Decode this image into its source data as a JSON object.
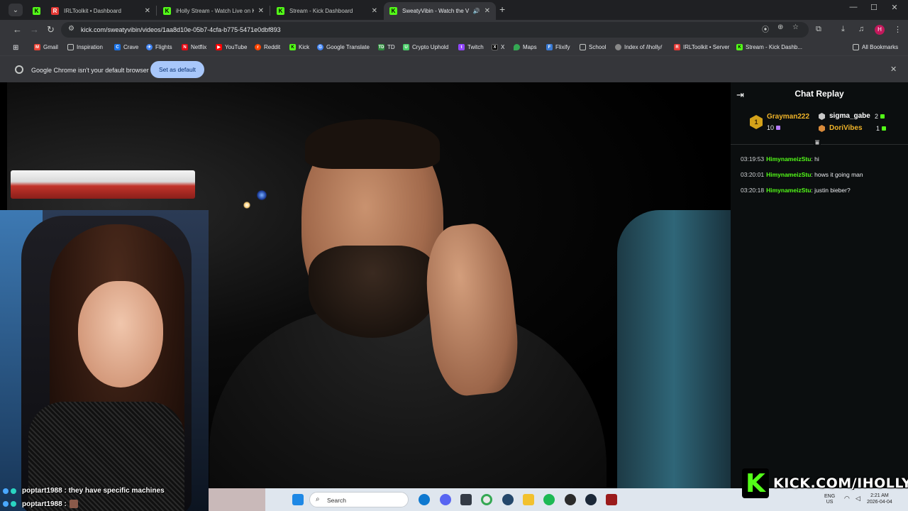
{
  "browser": {
    "tabs": [
      {
        "title": "",
        "favicon": "kick",
        "active": false
      },
      {
        "title": "IRLToolkit • Dashboard",
        "favicon": "irltoolkit",
        "active": false
      },
      {
        "title": "iHolly Stream - Watch Live on K",
        "favicon": "kick",
        "active": false
      },
      {
        "title": "Stream - Kick Dashboard",
        "favicon": "kick",
        "active": false
      },
      {
        "title": "SweatyVibin - Watch the V",
        "favicon": "kick",
        "active": true
      }
    ],
    "url": "kick.com/sweatyvibin/videos/1aa8d10e-05b7-4cfa-b775-5471e0dbf893",
    "profile_initial": "H",
    "bookmarks": [
      {
        "label": "Gmail",
        "icon": "gmail-icon",
        "color": "#ea4335"
      },
      {
        "label": "Inspiration",
        "icon": "folder-icon",
        "color": ""
      },
      {
        "label": "Crave",
        "icon": "crave-icon",
        "color": "#1a73e8"
      },
      {
        "label": "Flights",
        "icon": "flights-icon",
        "color": "#4285f4"
      },
      {
        "label": "Netflix",
        "icon": "netflix-icon",
        "color": "#e50914"
      },
      {
        "label": "YouTube",
        "icon": "youtube-icon",
        "color": "#ff0000"
      },
      {
        "label": "Reddit",
        "icon": "reddit-icon",
        "color": "#ff4500"
      },
      {
        "label": "Kick",
        "icon": "kick-icon",
        "color": "#53fc18"
      },
      {
        "label": "Google Translate",
        "icon": "translate-icon",
        "color": "#4285f4"
      },
      {
        "label": "TD",
        "icon": "td-icon",
        "color": "#2e8b3d"
      },
      {
        "label": "Crypto Uphold",
        "icon": "uphold-icon",
        "color": "#49cc68"
      },
      {
        "label": "Twitch",
        "icon": "twitch-icon",
        "color": "#9146ff"
      },
      {
        "label": "X",
        "icon": "x-icon",
        "color": "#000000"
      },
      {
        "label": "Maps",
        "icon": "maps-icon",
        "color": "#34a853"
      },
      {
        "label": "Flixify",
        "icon": "flixify-icon",
        "color": "#3a7bd5"
      },
      {
        "label": "School",
        "icon": "folder-icon",
        "color": ""
      },
      {
        "label": "Index of /iholly/",
        "icon": "globe-icon",
        "color": "#888888"
      },
      {
        "label": "IRLToolkit • Server",
        "icon": "irltoolkit-icon",
        "color": "#e53935"
      },
      {
        "label": "Stream - Kick Dashb...",
        "icon": "kick-icon",
        "color": "#53fc18"
      }
    ],
    "all_bookmarks": "All Bookmarks",
    "infobar_message": "Google Chrome isn't your default browser",
    "infobar_button": "Set as default"
  },
  "chat": {
    "title": "Chat Replay",
    "leaderboard": {
      "first": {
        "rank": "1",
        "name": "Grayman222",
        "count": "10"
      },
      "second": {
        "name": "sigma_gabe",
        "count": "2"
      },
      "third": {
        "name": "DoriVibes",
        "count": "1"
      }
    },
    "messages": [
      {
        "time": "03:19:53",
        "user": "HimynameizStu",
        "text": "hi"
      },
      {
        "time": "03:20:01",
        "user": "HimynameizStu",
        "text": "hows it going man"
      },
      {
        "time": "03:20:18",
        "user": "HimynameizStu",
        "text": "justin bieber?"
      }
    ]
  },
  "overlay": {
    "chat_lines": [
      {
        "user": "poptart1988",
        "text": "they have specific machines"
      },
      {
        "user": "poptart1988",
        "text": ""
      }
    ],
    "brand": "KICK.COM/IHOLLY",
    "brand_logo": "K"
  },
  "taskbar": {
    "search_label": "Search",
    "language": [
      "ENG",
      "US"
    ],
    "time": "2:21 AM",
    "date": "2026-04-04"
  },
  "colors": {
    "kick_green": "#53fc18",
    "gold": "#f0b429",
    "purple": "#b57bff"
  }
}
